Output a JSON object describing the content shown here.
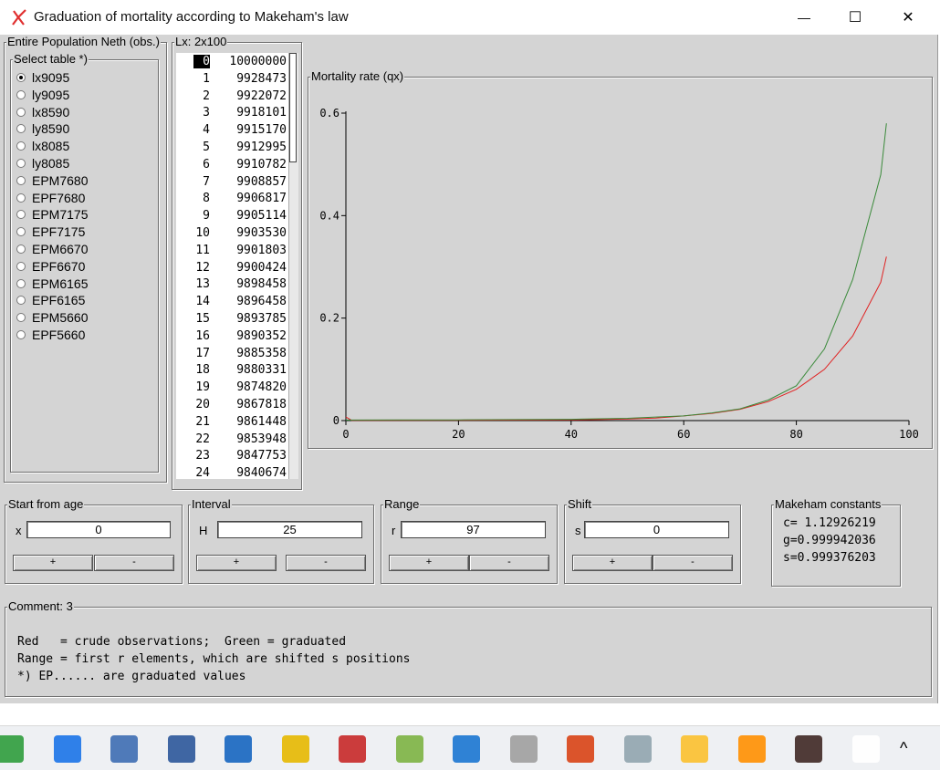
{
  "window": {
    "title": "Graduation of mortality according to Makeham's law",
    "minimize": "—",
    "maximize": "☐",
    "close": "✕"
  },
  "population_group": {
    "label": "Entire Population Neth (obs.)",
    "select_label": "Select table *)",
    "selected": "lx9095",
    "tables": [
      "lx9095",
      "ly9095",
      "lx8590",
      "ly8590",
      "lx8085",
      "ly8085",
      "EPM7680",
      "EPF7680",
      "EPM7175",
      "EPF7175",
      "EPM6670",
      "EPF6670",
      "EPM6165",
      "EPF6165",
      "EPM5660",
      "EPF5660"
    ]
  },
  "lx_group": {
    "label": "Lx: 2x100",
    "rows": [
      {
        "i": "0",
        "v": "10000000"
      },
      {
        "i": "1",
        "v": "9928473"
      },
      {
        "i": "2",
        "v": "9922072"
      },
      {
        "i": "3",
        "v": "9918101"
      },
      {
        "i": "4",
        "v": "9915170"
      },
      {
        "i": "5",
        "v": "9912995"
      },
      {
        "i": "6",
        "v": "9910782"
      },
      {
        "i": "7",
        "v": "9908857"
      },
      {
        "i": "8",
        "v": "9906817"
      },
      {
        "i": "9",
        "v": "9905114"
      },
      {
        "i": "10",
        "v": "9903530"
      },
      {
        "i": "11",
        "v": "9901803"
      },
      {
        "i": "12",
        "v": "9900424"
      },
      {
        "i": "13",
        "v": "9898458"
      },
      {
        "i": "14",
        "v": "9896458"
      },
      {
        "i": "15",
        "v": "9893785"
      },
      {
        "i": "16",
        "v": "9890352"
      },
      {
        "i": "17",
        "v": "9885358"
      },
      {
        "i": "18",
        "v": "9880331"
      },
      {
        "i": "19",
        "v": "9874820"
      },
      {
        "i": "20",
        "v": "9867818"
      },
      {
        "i": "21",
        "v": "9861448"
      },
      {
        "i": "22",
        "v": "9853948"
      },
      {
        "i": "23",
        "v": "9847753"
      },
      {
        "i": "24",
        "v": "9840674"
      }
    ]
  },
  "chart_data": {
    "type": "line",
    "title": "Mortality rate (qx)",
    "xlim": [
      0,
      100
    ],
    "ylim": [
      0,
      0.6
    ],
    "x_ticks": [
      "0",
      "20",
      "40",
      "60",
      "80",
      "100"
    ],
    "y_ticks": [
      "0",
      "0.2",
      "0.4",
      "0.6"
    ],
    "grid": false,
    "series": [
      {
        "color": "#e02020",
        "x": [
          0,
          1,
          2,
          3,
          35,
          40,
          45,
          50,
          55,
          60,
          65,
          70,
          75,
          80,
          85,
          90,
          95,
          96
        ],
        "y": [
          0.007,
          0.0006,
          0.0004,
          0.0003,
          0.001,
          0.0015,
          0.002,
          0.003,
          0.005,
          0.009,
          0.014,
          0.022,
          0.037,
          0.061,
          0.1,
          0.165,
          0.27,
          0.32
        ]
      },
      {
        "color": "#3a8a3a",
        "x": [
          0,
          10,
          20,
          30,
          40,
          45,
          50,
          55,
          60,
          65,
          70,
          75,
          80,
          85,
          90,
          95,
          96
        ],
        "y": [
          0.001,
          0.0012,
          0.0015,
          0.002,
          0.0025,
          0.0035,
          0.0045,
          0.007,
          0.009,
          0.015,
          0.023,
          0.04,
          0.068,
          0.14,
          0.275,
          0.48,
          0.58
        ]
      }
    ]
  },
  "start_age": {
    "label": "Start from age",
    "prefix": "x",
    "value": "0",
    "plus": "+",
    "minus": "-"
  },
  "interval": {
    "label": "Interval",
    "prefix": "H",
    "value": "25",
    "plus": "+",
    "minus": "-"
  },
  "range": {
    "label": "Range",
    "prefix": "r",
    "value": "97",
    "plus": "+",
    "minus": "-"
  },
  "shift": {
    "label": "Shift",
    "prefix": "s",
    "value": "0",
    "plus": "+",
    "minus": "-"
  },
  "makeham": {
    "label": "Makeham constants",
    "c": "c= 1.12926219",
    "g": "g=0.999942036",
    "s": "s=0.999376203"
  },
  "comment": {
    "label": "Comment: 3",
    "line1": "Red   = crude observations;  Green = graduated",
    "line2": "Range = first r elements, which are shifted s positions",
    "line3": "*) EP...... are graduated values"
  },
  "taskbar": {
    "icons": [
      "edge-icon",
      "firefox-icon",
      "notepad-icon",
      "word-icon",
      "formula-icon",
      "chart-app-icon",
      "filezilla-icon",
      "paint-icon",
      "window-app-icon",
      "calc5-icon",
      "cart-icon",
      "lambda-icon",
      "mail-icon",
      "fire-icon",
      "ee-icon",
      "makeham-icon"
    ],
    "tray_chevron": "^"
  },
  "colors": {
    "client_bg": "#d4d4d4",
    "accent_red": "#e02020",
    "graduated_green": "#3a8a3a"
  }
}
